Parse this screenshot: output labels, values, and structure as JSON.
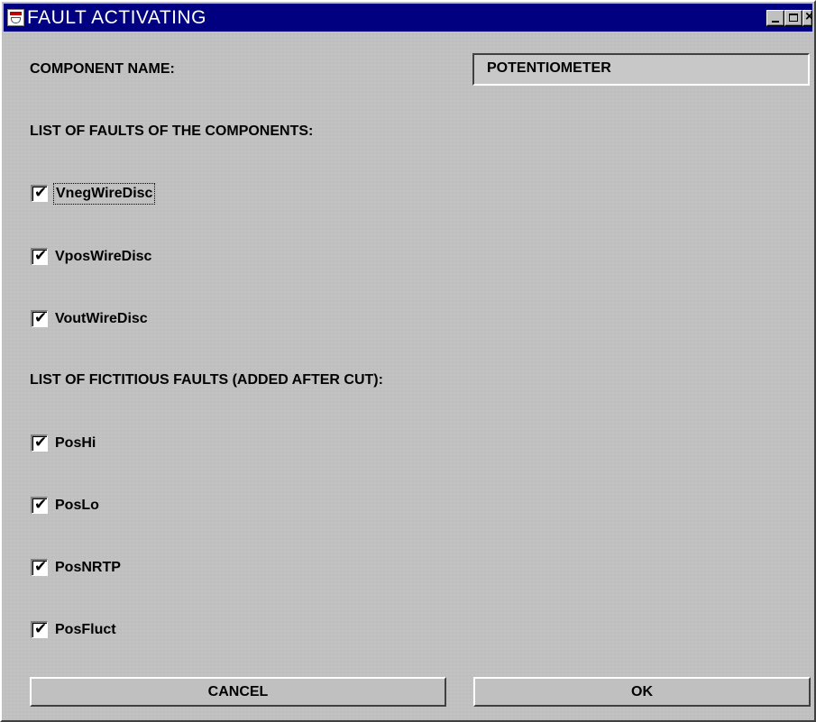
{
  "window": {
    "title": "FAULT ACTIVATING",
    "controls": {
      "close_glyph": "×"
    }
  },
  "component": {
    "label": "COMPONENT NAME:",
    "value": "POTENTIOMETER"
  },
  "faults_section": {
    "heading": "LIST OF FAULTS OF THE COMPONENTS:",
    "items": [
      {
        "label": "VnegWireDisc",
        "checked": true
      },
      {
        "label": "VposWireDisc",
        "checked": true
      },
      {
        "label": "VoutWireDisc",
        "checked": true
      }
    ]
  },
  "fictitious_section": {
    "heading": "LIST OF FICTITIOUS FAULTS (ADDED AFTER CUT):",
    "items": [
      {
        "label": "PosHi",
        "checked": true
      },
      {
        "label": "PosLo",
        "checked": true
      },
      {
        "label": "PosNRTP",
        "checked": true
      },
      {
        "label": "PosFluct",
        "checked": true
      }
    ]
  },
  "check_glyph": "✔",
  "buttons": {
    "cancel": "CANCEL",
    "ok": "OK"
  },
  "colors": {
    "titlebar": "#000080",
    "panel": "#c0c0c0"
  }
}
